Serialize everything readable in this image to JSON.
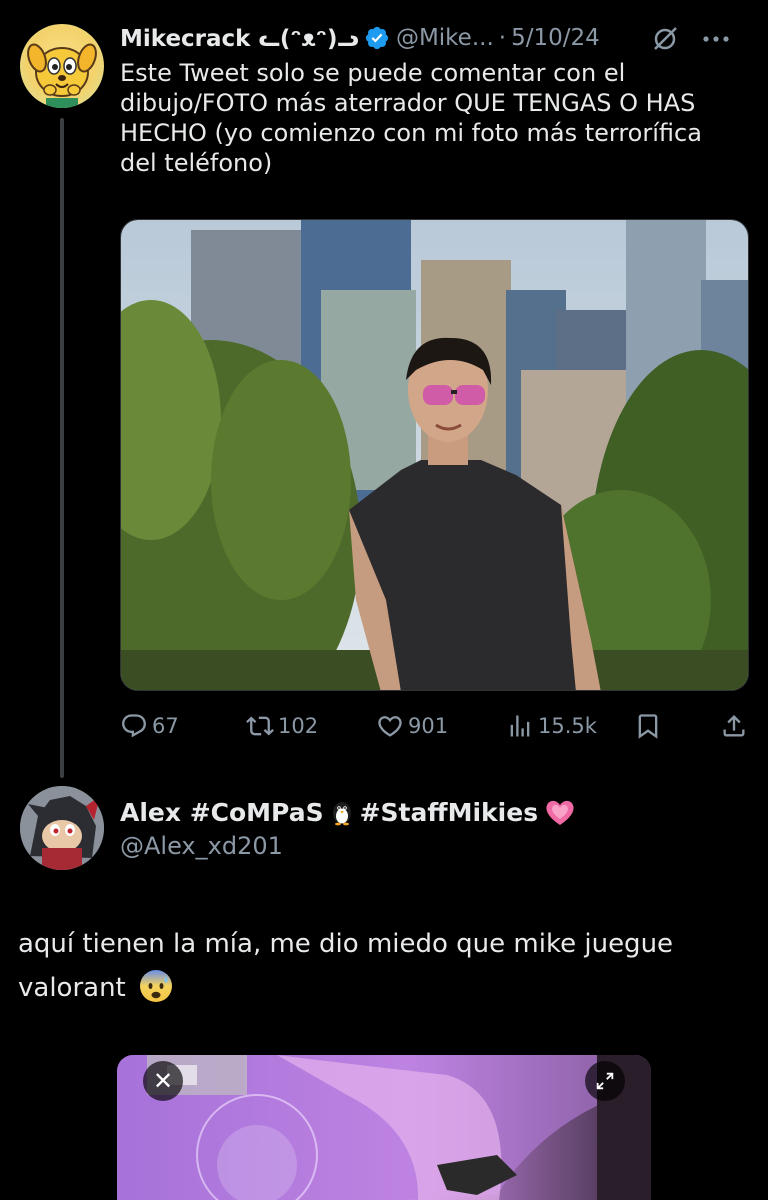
{
  "tweet": {
    "author_name": "Mikecrack ᓚ(ᵔᴥᵔ)ᓗ",
    "handle": "@Mike...",
    "separator": "·",
    "date": "5/10/24",
    "text": "Este Tweet solo se puede comentar con el dibujo/FOTO más aterrador QUE TENGAS O HAS HECHO (yo comienzo con mi foto más terrorífica del teléfono)",
    "verified": true,
    "accent_color": "#1d9bf0",
    "icons": {
      "avatar": "mikecrack-dog-avatar",
      "verified": "verified-badge-icon",
      "grok": "grok-icon",
      "more": "more-icon"
    },
    "actions": {
      "replies": "67",
      "retweets": "102",
      "likes": "901",
      "views": "15.5k"
    }
  },
  "reply": {
    "author_name_part1": "Alex #CoMPaS",
    "author_name_part2": "#StaffMikies",
    "name_emojis": [
      "penguin",
      "growing-heart"
    ],
    "handle": "@Alex_xd201",
    "text": "aquí tienen la mía, me dio miedo que mike juegue valorant",
    "text_emoji": "anxious-face-with-sweat",
    "media_controls": {
      "close": "✕",
      "expand": "expand-icon"
    }
  },
  "colors": {
    "background": "#000000",
    "text_primary": "#e7e9ea",
    "text_secondary": "#8b98a5",
    "thread_line": "#3b3f43"
  }
}
